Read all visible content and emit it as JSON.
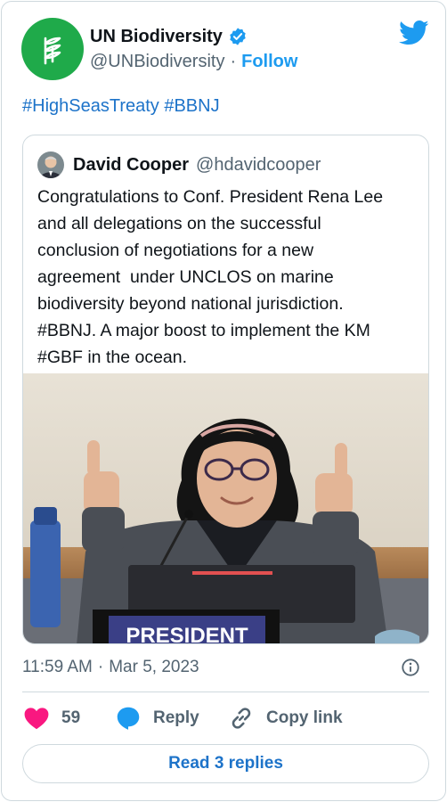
{
  "author": {
    "display_name": "UN Biodiversity",
    "handle": "@UNBiodiversity",
    "separator": "·",
    "follow_label": "Follow",
    "avatar_color": "#1faa4a",
    "avatar_icon": "leaf-logo-icon"
  },
  "tweet": {
    "hashtags": [
      "#HighSeasTreaty",
      "#BBNJ"
    ]
  },
  "quoted": {
    "display_name": "David Cooper",
    "handle": "@hdavidcooper",
    "text": "Congratulations to Conf. President Rena Lee\nand all delegations on the successful\nconclusion of negotiations for a new\nagreement  under UNCLOS on marine\nbiodiversity beyond national jurisdiction.\n#BBNJ. A major boost to implement the KM\n#GBF in the ocean.",
    "image_placard_text": "PRESIDENT"
  },
  "meta": {
    "time": "11:59 AM",
    "separator": "·",
    "date": "Mar 5, 2023"
  },
  "actions": {
    "like_count": "59",
    "reply_label": "Reply",
    "copy_label": "Copy link"
  },
  "read_replies_label": "Read 3 replies",
  "colors": {
    "brand_blue": "#1d9bf0",
    "link_blue": "#1d73c9",
    "like_pink": "#f91880",
    "muted": "#536471",
    "border": "#cfd9de"
  }
}
